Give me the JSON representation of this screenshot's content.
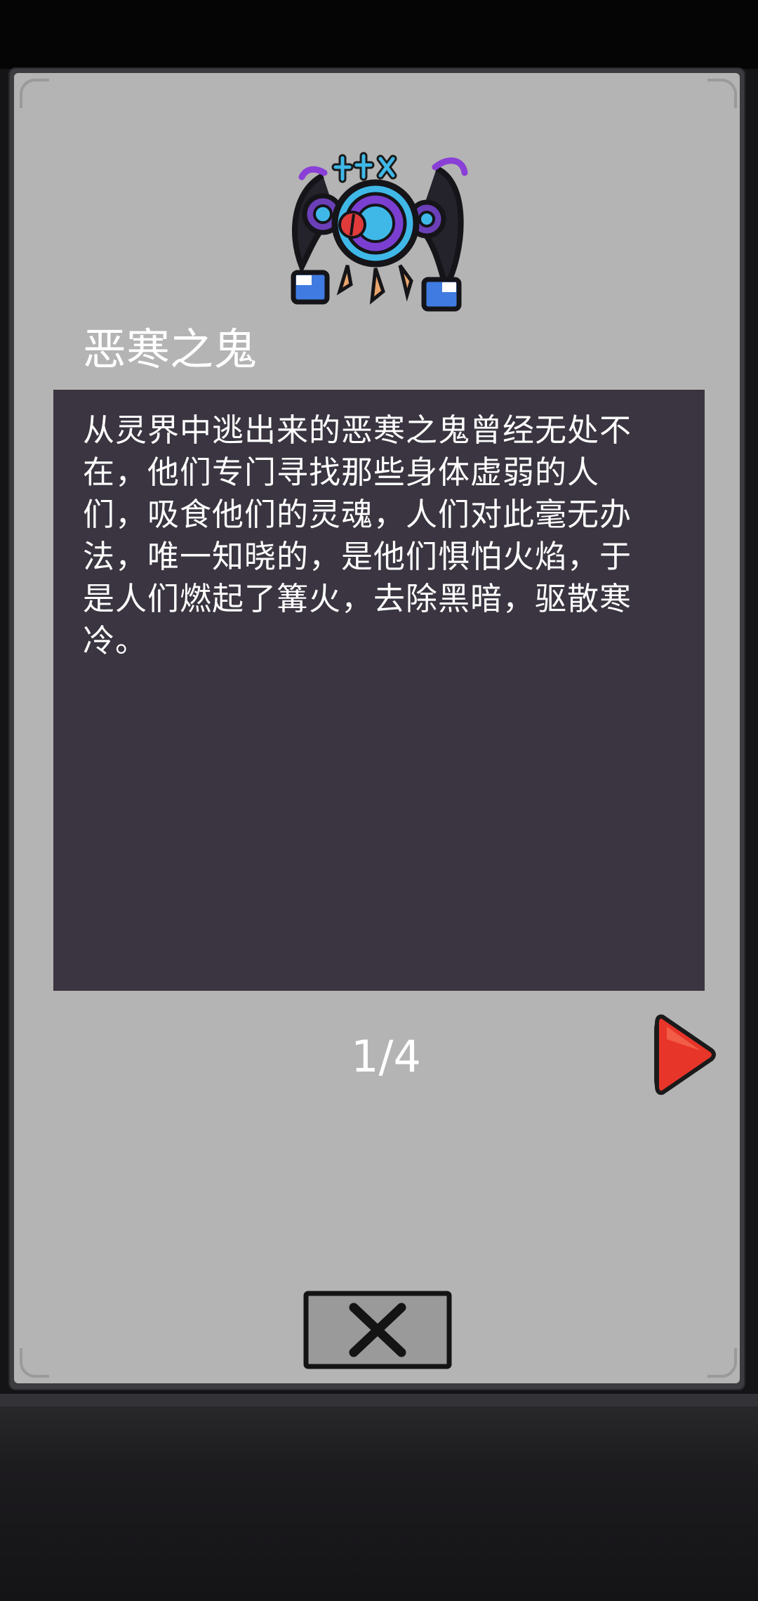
{
  "entry": {
    "name": "恶寒之鬼",
    "portrait_icon": "frost-ghost-icon",
    "description": "从灵界中逃出来的恶寒之鬼曾经无处不在，他们专门寻找那些身体虚弱的人们，吸食他们的灵魂，人们对此毫无办法，唯一知晓的，是他们惧怕火焰，于是人们燃起了篝火，去除黑暗，驱散寒冷。"
  },
  "pagination": {
    "current": 1,
    "total": 4,
    "label": "1/4",
    "next_icon": "red-arrow-right-icon"
  },
  "close_button": {
    "icon": "close-x-icon"
  },
  "colors": {
    "panel": "#b4b4b4",
    "description_box": "#3a3540",
    "text": "#ffffff",
    "next_arrow": "#e8352a"
  }
}
